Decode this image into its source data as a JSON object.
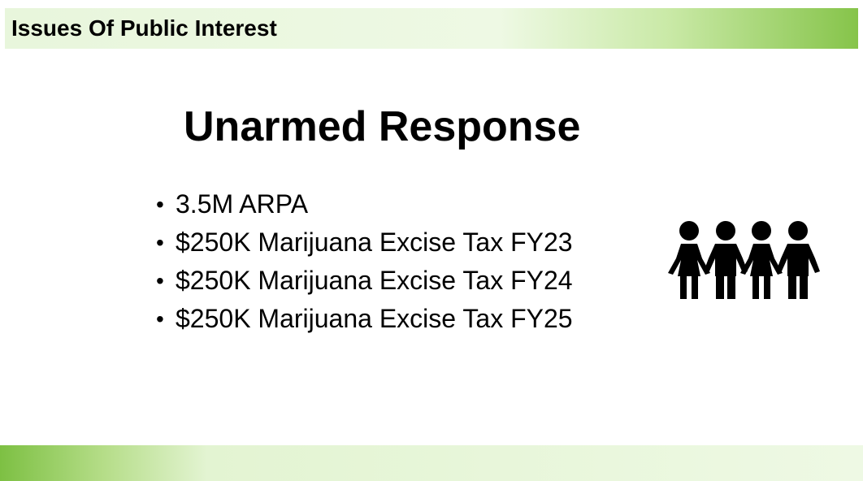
{
  "header": {
    "title": "Issues Of Public Interest"
  },
  "slide": {
    "heading": "Unarmed Response",
    "bullets": [
      "3.5M ARPA",
      "$250K Marijuana Excise Tax FY23",
      "$250K Marijuana Excise Tax FY24",
      "$250K Marijuana Excise Tax FY25"
    ],
    "bullet_symbol": "•",
    "icon": "people-group-icon"
  },
  "colors": {
    "accent_green": "#86c44a",
    "light_green": "#eef9e4",
    "text": "#000000"
  }
}
